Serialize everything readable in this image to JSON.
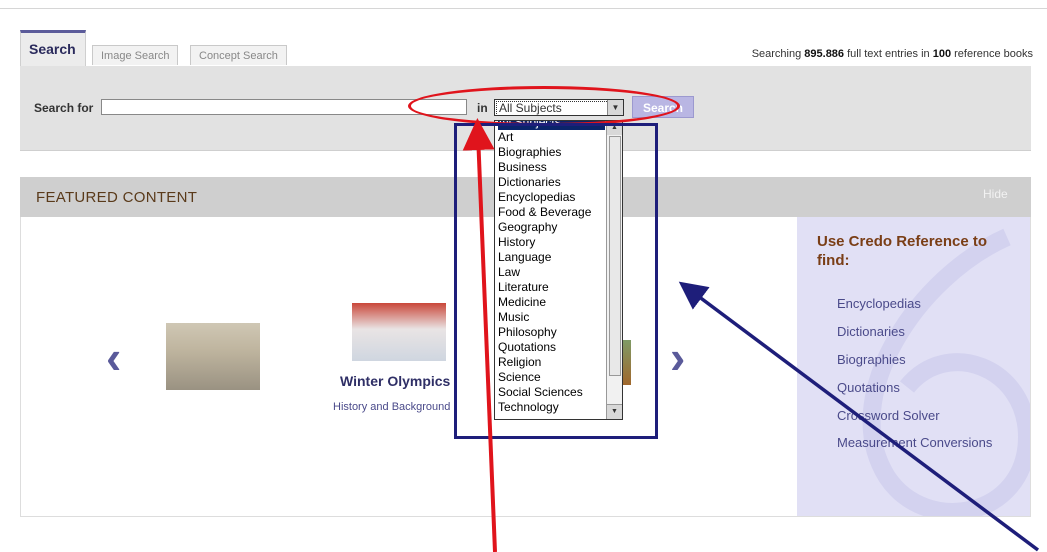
{
  "tabs": {
    "search": "Search",
    "image_search": "Image Search",
    "concept_search": "Concept Search"
  },
  "counts": {
    "prefix": "Searching ",
    "entries": "895.886",
    "middle": " full text entries in ",
    "books": "100",
    "suffix": " reference books"
  },
  "search": {
    "label": "Search for",
    "value": "",
    "in_label": "in",
    "selected_subject": "All Subjects",
    "button_label": "Search"
  },
  "dropdown_items": [
    "All Subjects",
    "Art",
    "Biographies",
    "Business",
    "Dictionaries",
    "Encyclopedias",
    "Food & Beverage",
    "Geography",
    "History",
    "Language",
    "Law",
    "Literature",
    "Medicine",
    "Music",
    "Philosophy",
    "Quotations",
    "Religion",
    "Science",
    "Social Sciences",
    "Technology"
  ],
  "featured": {
    "title": "FEATURED CONTENT",
    "hide_label": "Hide",
    "card_title": "Winter Olympics",
    "card_subtitle": "History and Background"
  },
  "side": {
    "title": "Use Credo Reference to find:",
    "links": [
      "Encyclopedias",
      "Dictionaries",
      "Biographies",
      "Quotations",
      "Crossword Solver",
      "Measurement Conversions"
    ]
  },
  "colors": {
    "annotation_red": "#e0141c",
    "annotation_navy": "#1e1e7a",
    "accent_purple": "#5b5b9a"
  }
}
